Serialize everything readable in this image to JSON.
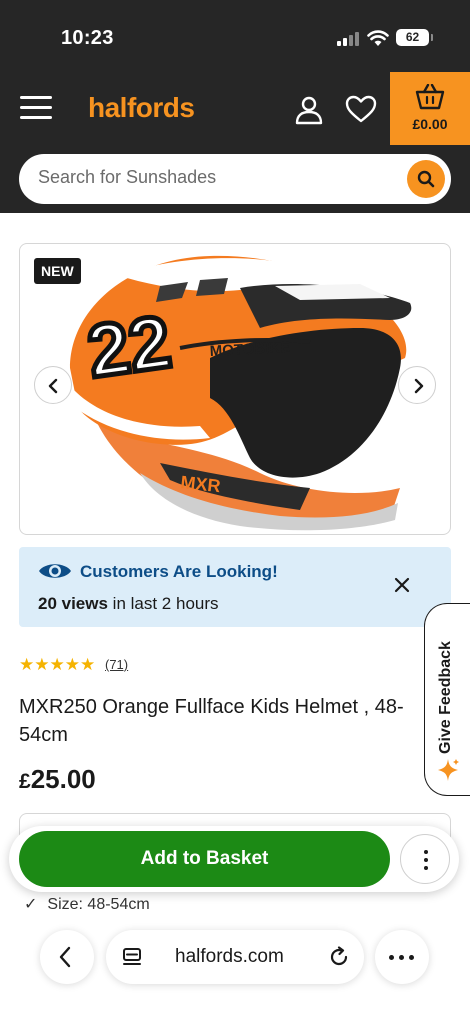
{
  "status_bar": {
    "time": "10:23",
    "battery": "62"
  },
  "header": {
    "logo": "halfords",
    "basket_total": "£0.00",
    "brand_color": "#f79320"
  },
  "search": {
    "placeholder": "Search for Sunshades"
  },
  "product": {
    "badge": "NEW",
    "helmet_number": "22",
    "helmet_brand_text": "MOTOBIKE",
    "rating_stars": 5,
    "review_count": "(71)",
    "title": "MXR250 Orange Fullface Kids Helmet , 48-54cm",
    "price_currency": "£",
    "price_amount": "25.00",
    "size_line": "Size: 48-54cm"
  },
  "looking_banner": {
    "title": "Customers Are Looking!",
    "views_bold": "20 views",
    "views_rest": " in last 2 hours"
  },
  "feedback": {
    "label": "Give Feedback"
  },
  "actions": {
    "add_to_basket": "Add to Basket"
  },
  "browser": {
    "url": "halfords.com"
  },
  "colors": {
    "add_button": "#1c8a15",
    "banner_bg": "#dcedf9",
    "banner_title": "#0d4d87",
    "star": "#f5b301"
  }
}
